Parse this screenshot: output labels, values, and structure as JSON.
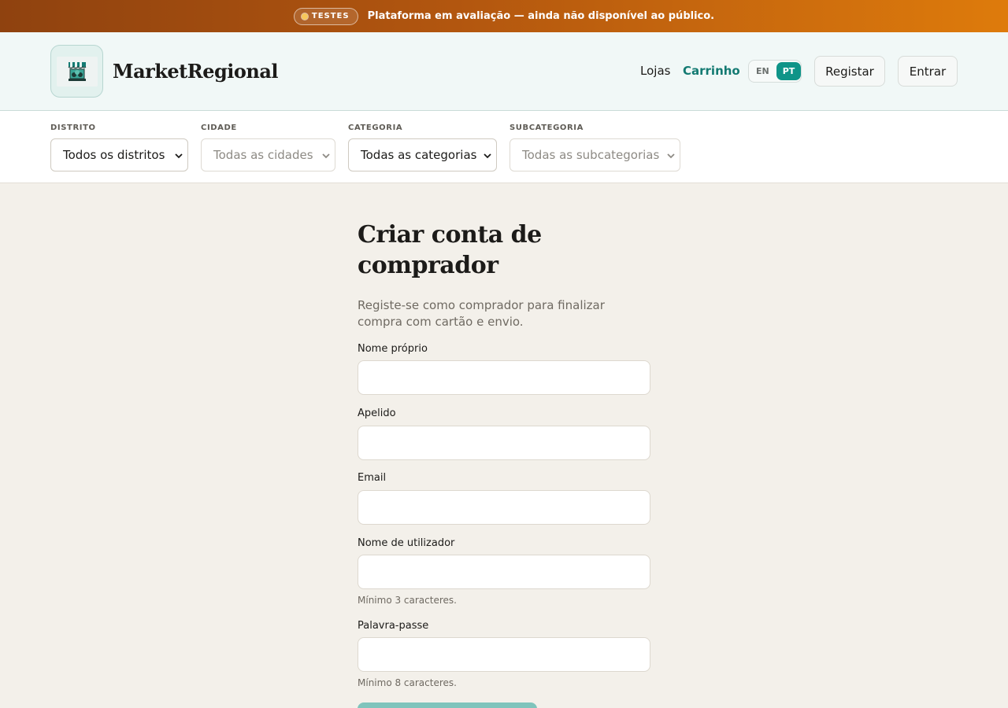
{
  "banner": {
    "badge": "TESTES",
    "message": "Plataforma em avaliação — ainda não disponível ao público."
  },
  "header": {
    "brand": "MarketRegional",
    "logo_icon": "market-stall-icon",
    "nav": {
      "lojas": "Lojas",
      "carrinho": "Carrinho"
    },
    "languages": {
      "en": "EN",
      "pt": "PT",
      "active": "PT"
    },
    "registar": "Registar",
    "entrar": "Entrar",
    "accent_color": "#0f9488"
  },
  "filters": {
    "distrito": {
      "label": "DISTRITO",
      "value": "Todos os distritos"
    },
    "cidade": {
      "label": "CIDADE",
      "value": "Todas as cidades"
    },
    "categoria": {
      "label": "CATEGORIA",
      "value": "Todas as categorias"
    },
    "subcategoria": {
      "label": "SUBCATEGORIA",
      "value": "Todas as subcategorias"
    }
  },
  "form": {
    "title": "Criar conta de comprador",
    "subtitle": "Registe-se como comprador para finalizar compra com cartão e envio.",
    "fields": {
      "first_name": {
        "label": "Nome próprio",
        "value": ""
      },
      "last_name": {
        "label": "Apelido",
        "value": ""
      },
      "email": {
        "label": "Email",
        "value": ""
      },
      "username": {
        "label": "Nome de utilizador",
        "value": "",
        "hint": "Mínimo 3 caracteres."
      },
      "password": {
        "label": "Palavra-passe",
        "value": "",
        "hint": "Mínimo 8 caracteres."
      }
    }
  }
}
